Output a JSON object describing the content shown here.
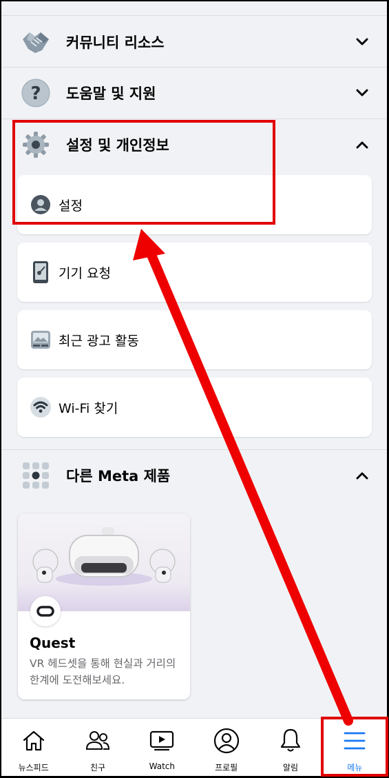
{
  "sections": {
    "community": {
      "label": "커뮤니티 리소스",
      "icon": "handshake-icon"
    },
    "help": {
      "label": "도움말 및 지원",
      "icon": "question-icon"
    },
    "settings": {
      "label": "설정 및 개인정보",
      "icon": "gear-icon"
    },
    "meta": {
      "label": "다른 Meta 제품",
      "icon": "grid-icon"
    }
  },
  "settings_items": [
    {
      "label": "설정",
      "icon": "person-icon"
    },
    {
      "label": "기기 요청",
      "icon": "device-key-icon"
    },
    {
      "label": "최근 광고 활동",
      "icon": "image-card-icon"
    },
    {
      "label": "Wi-Fi 찾기",
      "icon": "wifi-icon"
    }
  ],
  "quest": {
    "title": "Quest",
    "description": "VR 헤드셋을 통해 현실과 거리의 한계에 도전해보세요."
  },
  "tabbar": {
    "tabs": [
      {
        "label": "뉴스피드",
        "icon": "home-icon"
      },
      {
        "label": "친구",
        "icon": "friends-icon"
      },
      {
        "label": "Watch",
        "icon": "watch-icon"
      },
      {
        "label": "프로필",
        "icon": "profile-icon"
      },
      {
        "label": "알림",
        "icon": "bell-icon"
      },
      {
        "label": "메뉴",
        "icon": "menu-icon"
      }
    ],
    "active": "메뉴"
  },
  "colors": {
    "accent": "#1877f2",
    "annotation": "#e10000",
    "background": "#f0f2f5"
  }
}
